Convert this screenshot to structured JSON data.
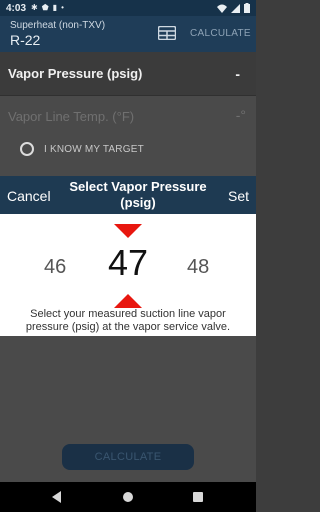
{
  "status_bar": {
    "time": "4:03",
    "icons": [
      "gear-icon",
      "shield-icon",
      "sim-icon",
      "dot-icon"
    ],
    "right_icons": [
      "wifi-icon",
      "signal-icon",
      "battery-icon"
    ]
  },
  "app_bar": {
    "subtitle": "Superheat (non-TXV)",
    "title": "R-22",
    "calculator_icon": "table-icon",
    "calculate_label": "CALCULATE"
  },
  "fields": {
    "vapor_pressure": {
      "label": "Vapor Pressure (psig)",
      "value": "-"
    },
    "vapor_line_temp": {
      "label": "Vapor Line Temp. (°F)",
      "value": "-°"
    },
    "target_option": {
      "label": "I KNOW MY TARGET"
    }
  },
  "dialog": {
    "cancel_label": "Cancel",
    "title": "Select Vapor Pressure (psig)",
    "set_label": "Set",
    "picker": {
      "previous": "46",
      "current": "47",
      "next": "48"
    },
    "help_text": "Select your measured suction line vapor pressure (psig) at the vapor service valve."
  },
  "calculate_button": {
    "label": "CALCULATE"
  },
  "colors": {
    "status_bar": "#16324a",
    "app_bar": "#1f3d58",
    "dialog_header": "#1e3a52",
    "arrow": "#e8170f",
    "button_disabled": "#1a3046"
  },
  "nav_bar": {
    "icons": [
      "back-icon",
      "home-icon",
      "recents-icon"
    ]
  }
}
